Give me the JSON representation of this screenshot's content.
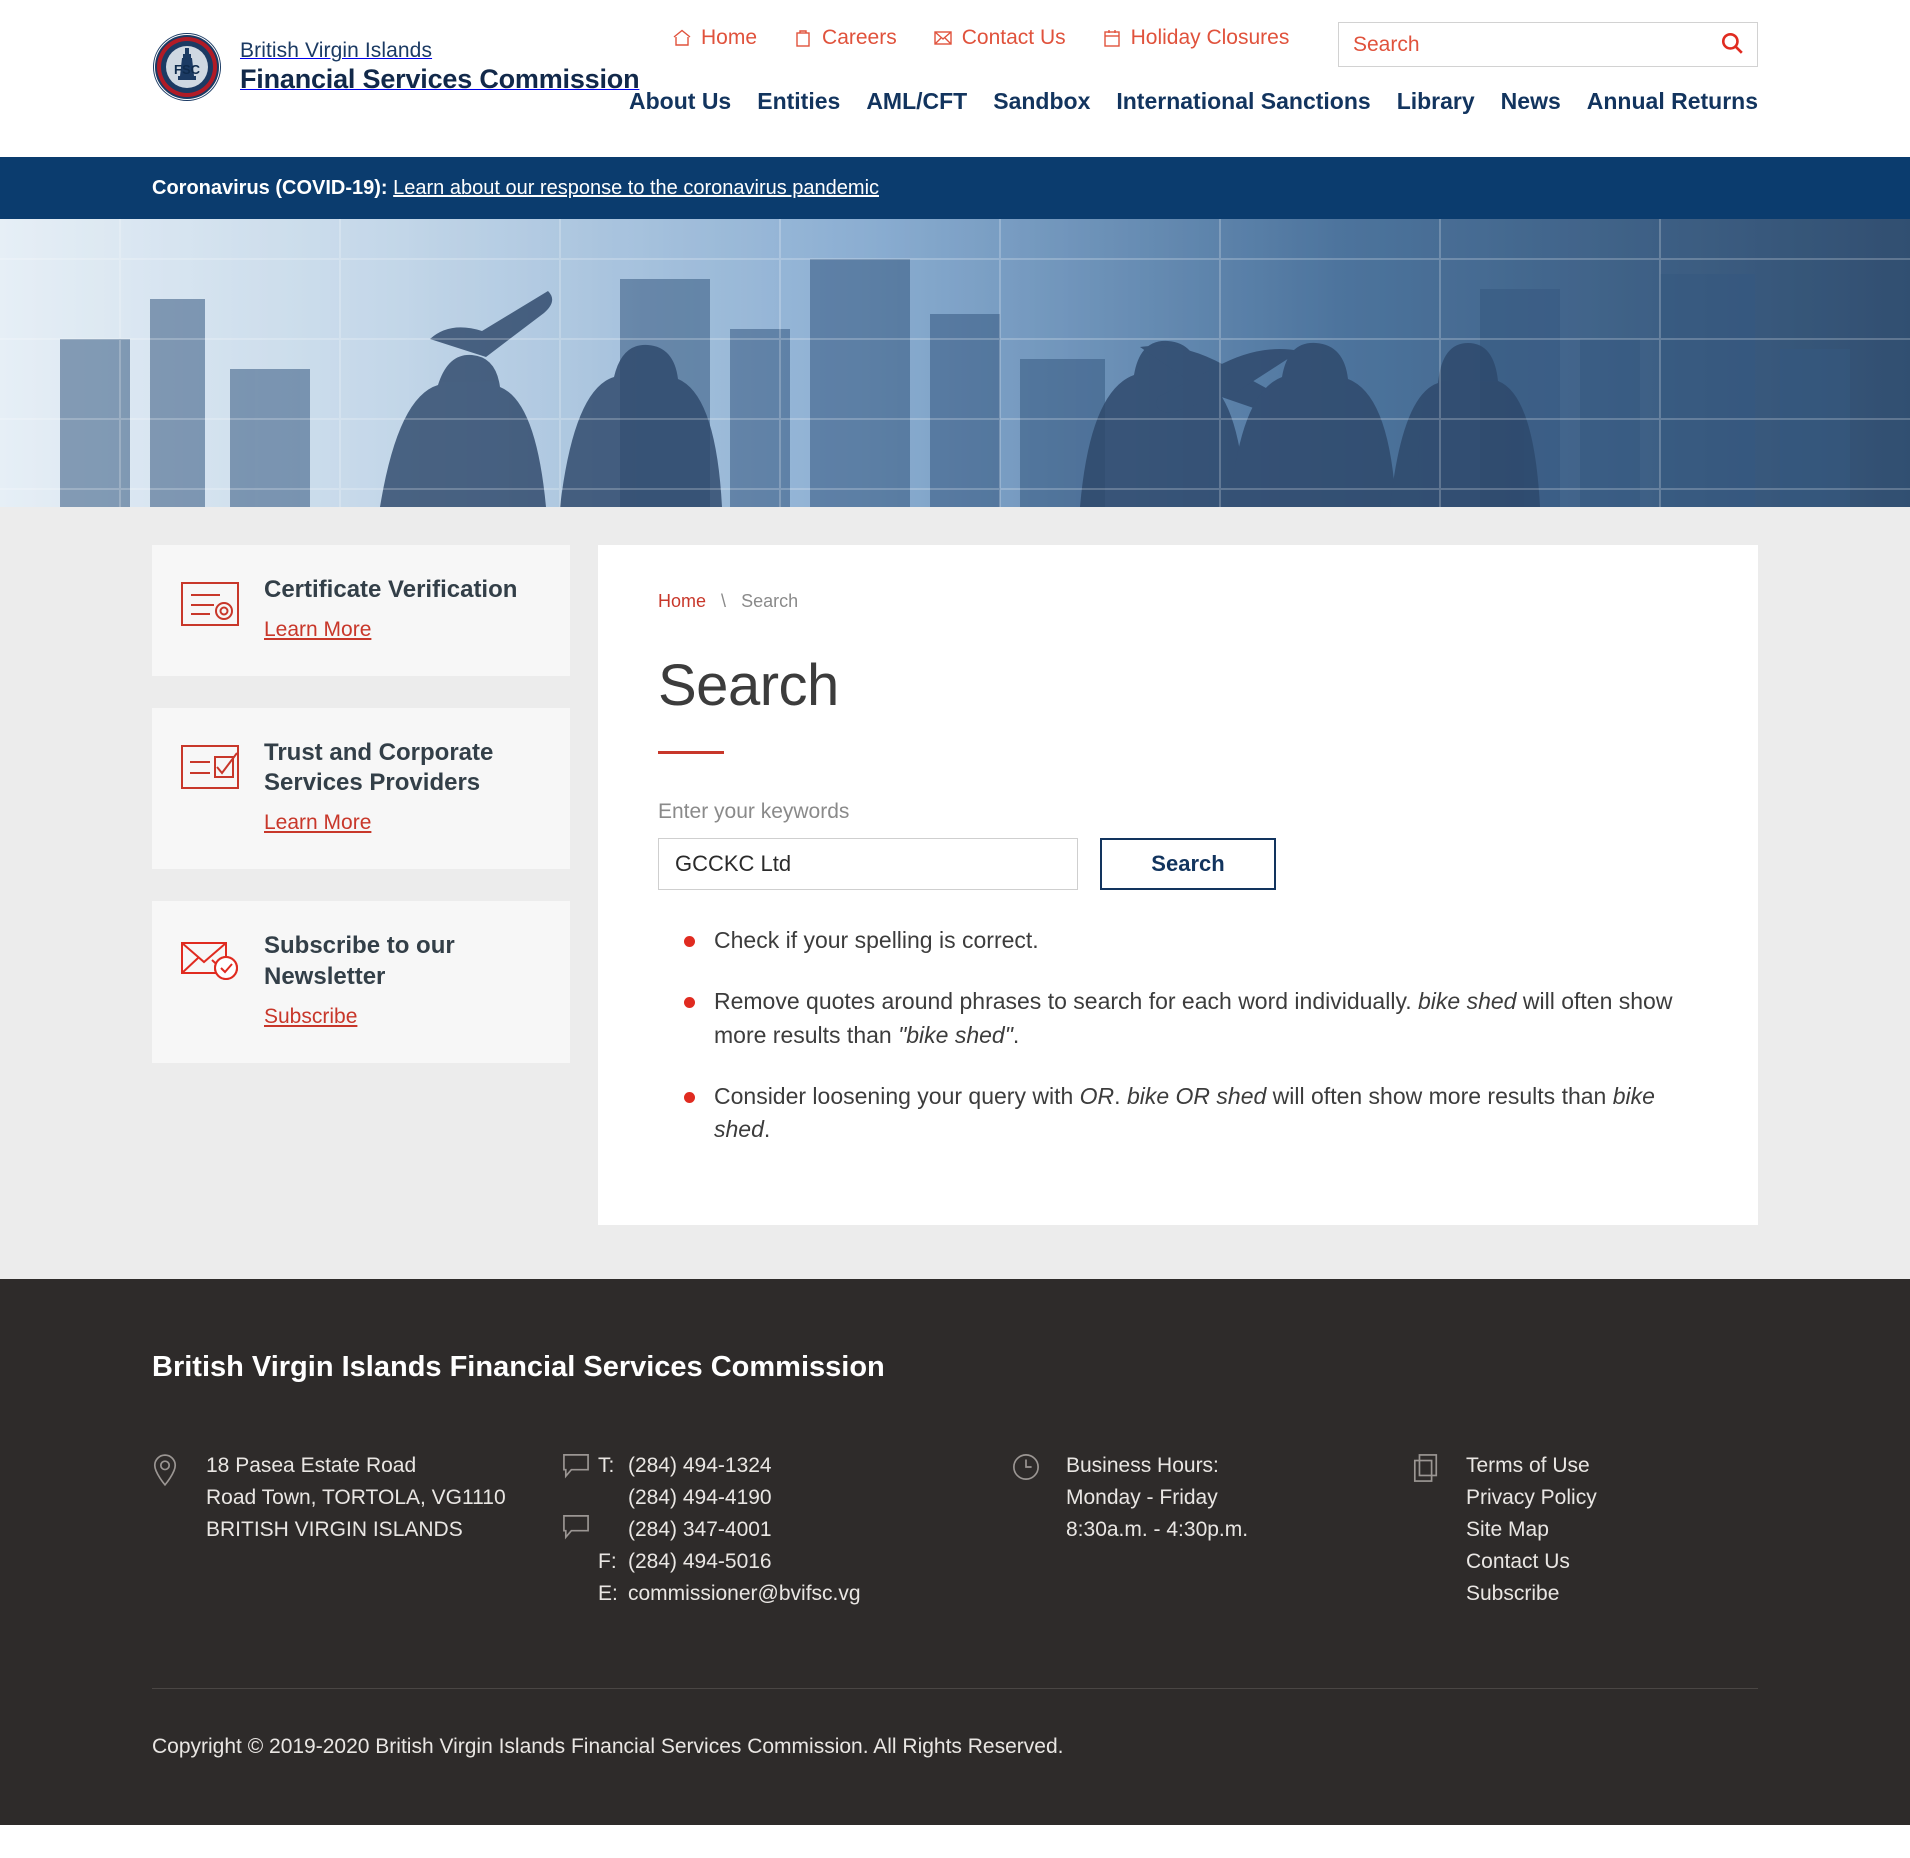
{
  "brand": {
    "line1": "British Virgin Islands",
    "line2": "Financial Services Commission",
    "seal_text": "FSC"
  },
  "header": {
    "utility_nav": [
      {
        "label": "Home",
        "icon": "home-icon"
      },
      {
        "label": "Careers",
        "icon": "briefcase-icon"
      },
      {
        "label": "Contact Us",
        "icon": "envelope-icon"
      },
      {
        "label": "Holiday Closures",
        "icon": "calendar-icon"
      }
    ],
    "search": {
      "placeholder": "Search",
      "value": "",
      "icon": "search-icon"
    },
    "main_nav": [
      "About Us",
      "Entities",
      "AML/CFT",
      "Sandbox",
      "International Sanctions",
      "Library",
      "News",
      "Annual Returns"
    ]
  },
  "covid_banner": {
    "label": "Coronavirus (COVID-19):",
    "link_text": "Learn about our response to the coronavirus pandemic",
    "background": "#0b3c6e"
  },
  "sidebar": {
    "cards": [
      {
        "title": "Certificate Verification",
        "link": "Learn More",
        "icon": "certificate-seal-icon"
      },
      {
        "title": "Trust and Corporate Services Providers",
        "link": "Learn More",
        "icon": "document-check-icon"
      },
      {
        "title": "Subscribe to our Newsletter",
        "link": "Subscribe",
        "icon": "envelope-check-icon"
      }
    ]
  },
  "main": {
    "breadcrumb": {
      "home": "Home",
      "separator": "\\",
      "current": "Search"
    },
    "title": "Search",
    "form": {
      "label": "Enter your keywords",
      "value": "GCCKC Ltd",
      "placeholder": "",
      "button": "Search"
    },
    "tips": [
      {
        "parts": [
          {
            "t": "Check if your spelling is correct.",
            "i": false
          }
        ]
      },
      {
        "parts": [
          {
            "t": "Remove quotes around phrases to search for each word individually. ",
            "i": false
          },
          {
            "t": "bike shed",
            "i": true
          },
          {
            "t": " will often show more results than ",
            "i": false
          },
          {
            "t": "\"bike shed\"",
            "i": true
          },
          {
            "t": ".",
            "i": false
          }
        ]
      },
      {
        "parts": [
          {
            "t": "Consider loosening your query with ",
            "i": false
          },
          {
            "t": "OR",
            "i": true
          },
          {
            "t": ". ",
            "i": false
          },
          {
            "t": "bike OR shed",
            "i": true
          },
          {
            "t": " will often show more results than ",
            "i": false
          },
          {
            "t": "bike shed",
            "i": true
          },
          {
            "t": ".",
            "i": false
          }
        ]
      }
    ]
  },
  "footer": {
    "title": "British Virgin Islands Financial Services Commission",
    "address": {
      "icon": "map-pin-icon",
      "lines": [
        "18 Pasea Estate Road",
        "Road Town, TORTOLA, VG1110",
        "BRITISH VIRGIN ISLANDS"
      ]
    },
    "contact": {
      "icon": "speech-bubble-icon",
      "rows": [
        {
          "label": "T:",
          "value": "(284) 494-1324"
        },
        {
          "label": "",
          "value": "(284) 494-4190"
        },
        {
          "label": "",
          "value": "(284) 347-4001"
        },
        {
          "label": "F:",
          "value": "(284) 494-5016"
        },
        {
          "label": "E:",
          "value": "commissioner@bvifsc.vg"
        }
      ]
    },
    "hours": {
      "icon": "clock-icon",
      "lines": [
        "Business Hours:",
        "Monday - Friday",
        "8:30a.m. - 4:30p.m."
      ]
    },
    "links": {
      "icon": "pages-icon",
      "items": [
        "Terms of Use",
        "Privacy Policy",
        "Site Map",
        "Contact Us",
        "Subscribe"
      ]
    },
    "copyright": "Copyright © 2019-2020 British Virgin Islands Financial Services Commission. All Rights Reserved."
  },
  "colors": {
    "navy": "#12345e",
    "banner_navy": "#0b3c6e",
    "red": "#c8372a",
    "utility_red": "#e0523c",
    "footer_bg": "#2e2b2a",
    "body_bg": "#ececec"
  }
}
